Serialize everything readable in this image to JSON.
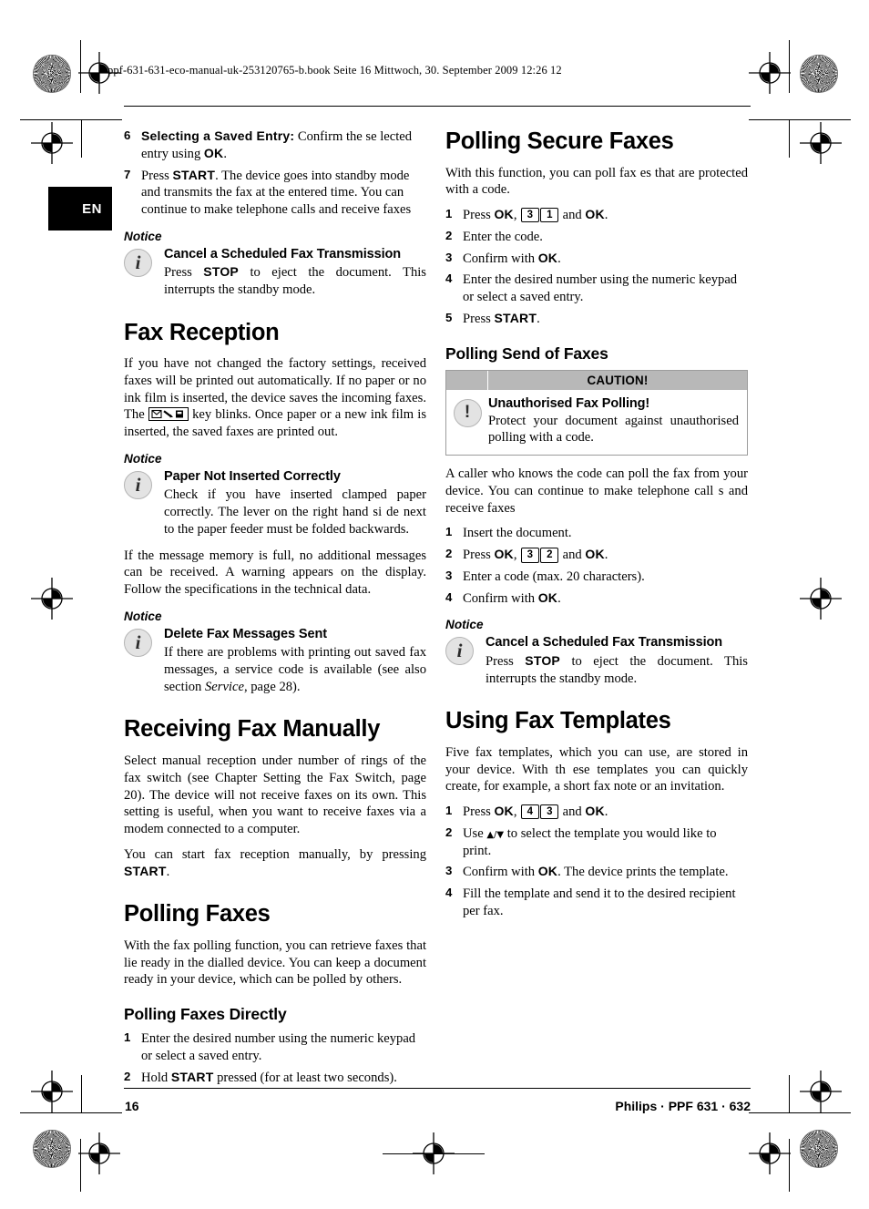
{
  "page": {
    "file_header": "ppf-631-631-eco-manual-uk-253120765-b.book  Seite 16  Mittwoch, 30. September 2009  12:26 12",
    "language_tab": "EN",
    "footer_page_number": "16",
    "footer_brand": "Philips · PPF 631 · 632",
    "colors": {
      "caution_header_bg": "#b8b8b8",
      "notice_icon_bg": "#e3e3e3",
      "notice_icon_border": "#b5b5b5",
      "language_tab_bg": "#000000",
      "text": "#000000"
    }
  },
  "left_column": {
    "continued_steps": [
      {
        "num": "6",
        "parts": [
          {
            "type": "bold-sans",
            "text": "Selecting a Saved Entry:"
          },
          {
            "type": "text",
            "text": " Confirm  the se lected entry using "
          },
          {
            "type": "bold-sans",
            "text": "OK"
          },
          {
            "type": "text",
            "text": "."
          }
        ]
      },
      {
        "num": "7",
        "parts": [
          {
            "type": "text",
            "text": "Press "
          },
          {
            "type": "bold-sans",
            "text": "START"
          },
          {
            "type": "text",
            "text": ". The device goes into standby mode and transmits the fax at the entered time. You can continue to make telephone calls and receive faxes"
          }
        ]
      }
    ],
    "notice_1": {
      "label": "Notice",
      "icon": "info-i-icon",
      "title": "Cancel a Scheduled Fax Transmission",
      "body_parts": [
        {
          "type": "text",
          "text": "Press "
        },
        {
          "type": "bold-sans",
          "text": "STOP"
        },
        {
          "type": "text",
          "text": " to eject the document. This interrupts the standby mode."
        }
      ]
    },
    "fax_reception": {
      "heading": "Fax Reception",
      "para_1_part_a": "If you have not changed the factory settings, received faxes will be printed  out automatically. If no paper or no ink film is inserted, the device saves the incoming faxes.  The ",
      "key_glyph": "fax-message-key-icon",
      "para_1_part_b": " key blinks. Once paper or a new   ink film is inserted, the saved faxes are printed out."
    },
    "notice_2": {
      "label": "Notice",
      "icon": "info-i-icon",
      "title": "Paper Not Inserted Correctly",
      "body": "Check if you have  inserted clamped paper correctly. The lever on the right hand si de next to the paper feeder must be folded backwards."
    },
    "memory_para": "If the message memory is full, no additional messages can be received. A warning appears on the display. Follow the specifications in the technical data.",
    "notice_3": {
      "label": "Notice",
      "icon": "info-i-icon",
      "title": "Delete Fax Messages Sent",
      "body_parts": [
        {
          "type": "text",
          "text": "If there are problems with printing out saved fax messages, a service code is available (see also section "
        },
        {
          "type": "italic",
          "text": "Service"
        },
        {
          "type": "text",
          "text": ", page 28)."
        }
      ]
    },
    "receiving_manually": {
      "heading": "Receiving Fax Manually",
      "para_1": "Select manual reception under number of rings of the fax switch (see Chapter Setting the Fax Switch, page 20). The device will not receive faxes on its own. This setting is useful, when you want to receive faxes via a modem connected to a computer.",
      "para_2_parts": [
        {
          "type": "text",
          "text": "You can start fax reception manually, by pressing "
        },
        {
          "type": "bold-sans",
          "text": "START"
        },
        {
          "type": "text",
          "text": "."
        }
      ]
    },
    "polling_faxes": {
      "heading": "Polling Faxes",
      "para_1": "With the fax polling function, you can retrieve faxes that lie ready in the dialled device.  You can keep a document ready in your device, which can be polled by others.",
      "subheading": "Polling Faxes Directly",
      "steps": [
        {
          "num": "1",
          "parts": [
            {
              "type": "text",
              "text": "Enter the desired number using the numeric keypad or select a saved entry."
            }
          ]
        },
        {
          "num": "2",
          "parts": [
            {
              "type": "text",
              "text": "Hold "
            },
            {
              "type": "bold-sans",
              "text": "START"
            },
            {
              "type": "text",
              "text": " pressed (for at least two seconds)."
            }
          ]
        }
      ]
    }
  },
  "right_column": {
    "polling_secure": {
      "heading": "Polling Secure Faxes",
      "para_1": "With this function, you can poll fax es that are protected with a code.",
      "steps": [
        {
          "num": "1",
          "parts": [
            {
              "type": "text",
              "text": "Press "
            },
            {
              "type": "bold-sans",
              "text": "OK"
            },
            {
              "type": "text",
              "text": ", "
            },
            {
              "type": "keycap",
              "text": "3"
            },
            {
              "type": "keycap",
              "text": "1"
            },
            {
              "type": "text",
              "text": " and "
            },
            {
              "type": "bold-sans",
              "text": "OK"
            },
            {
              "type": "text",
              "text": "."
            }
          ]
        },
        {
          "num": "2",
          "parts": [
            {
              "type": "text",
              "text": "Enter the code."
            }
          ]
        },
        {
          "num": "3",
          "parts": [
            {
              "type": "text",
              "text": "Confirm with "
            },
            {
              "type": "bold-sans",
              "text": "OK"
            },
            {
              "type": "text",
              "text": "."
            }
          ]
        },
        {
          "num": "4",
          "parts": [
            {
              "type": "text",
              "text": "Enter the desired number using the numeric keypad or select a saved entry."
            }
          ]
        },
        {
          "num": "5",
          "parts": [
            {
              "type": "text",
              "text": "Press "
            },
            {
              "type": "bold-sans",
              "text": "START"
            },
            {
              "type": "text",
              "text": "."
            }
          ]
        }
      ]
    },
    "polling_send": {
      "heading": "Polling Send of Faxes",
      "caution": {
        "header_label": "CAUTION!",
        "icon": "exclamation-circle-icon",
        "title": "Unauthorised Fax Polling!",
        "body": "Protect your document against unauthorised polling with a code."
      },
      "para_1": "A caller who knows the code can poll the fax from   your device. You can continue to   make telephone call s and receive faxes",
      "steps": [
        {
          "num": "1",
          "parts": [
            {
              "type": "text",
              "text": "Insert the document."
            }
          ]
        },
        {
          "num": "2",
          "parts": [
            {
              "type": "text",
              "text": "Press "
            },
            {
              "type": "bold-sans",
              "text": "OK"
            },
            {
              "type": "text",
              "text": ", "
            },
            {
              "type": "keycap",
              "text": "3"
            },
            {
              "type": "keycap",
              "text": "2"
            },
            {
              "type": "text",
              "text": " and "
            },
            {
              "type": "bold-sans",
              "text": "OK"
            },
            {
              "type": "text",
              "text": "."
            }
          ]
        },
        {
          "num": "3",
          "parts": [
            {
              "type": "text",
              "text": "Enter a code (max. 20 characters)."
            }
          ]
        },
        {
          "num": "4",
          "parts": [
            {
              "type": "text",
              "text": "Confirm with "
            },
            {
              "type": "bold-sans",
              "text": "OK"
            },
            {
              "type": "text",
              "text": "."
            }
          ]
        }
      ]
    },
    "notice_1": {
      "label": "Notice",
      "icon": "info-i-icon",
      "title": "Cancel a Scheduled Fax Transmission",
      "body_parts": [
        {
          "type": "text",
          "text": "Press "
        },
        {
          "type": "bold-sans",
          "text": "STOP"
        },
        {
          "type": "text",
          "text": " to eject the document. This interrupts the standby mode."
        }
      ]
    },
    "using_templates": {
      "heading": "Using Fax Templates",
      "para_1": "Five fax templates, which you can use, are stored in your device. With th ese templates you can quickly create, for example, a short fax note or an invitation.",
      "steps": [
        {
          "num": "1",
          "parts": [
            {
              "type": "text",
              "text": "Press "
            },
            {
              "type": "bold-sans",
              "text": "OK"
            },
            {
              "type": "text",
              "text": ", "
            },
            {
              "type": "keycap",
              "text": "4"
            },
            {
              "type": "keycap",
              "text": "3"
            },
            {
              "type": "text",
              "text": " and "
            },
            {
              "type": "bold-sans",
              "text": "OK"
            },
            {
              "type": "text",
              "text": "."
            }
          ]
        },
        {
          "num": "2",
          "parts": [
            {
              "type": "text",
              "text": "Use "
            },
            {
              "type": "arrows",
              "text": "▲/▼"
            },
            {
              "type": "text",
              "text": " to select the template you would like to print."
            }
          ]
        },
        {
          "num": "3",
          "parts": [
            {
              "type": "text",
              "text": "Confirm with "
            },
            {
              "type": "bold-sans",
              "text": "OK"
            },
            {
              "type": "text",
              "text": ". The device prints the template."
            }
          ]
        },
        {
          "num": "4",
          "parts": [
            {
              "type": "text",
              "text": "Fill the template and send it to the desired recipient per fax."
            }
          ]
        }
      ]
    }
  }
}
